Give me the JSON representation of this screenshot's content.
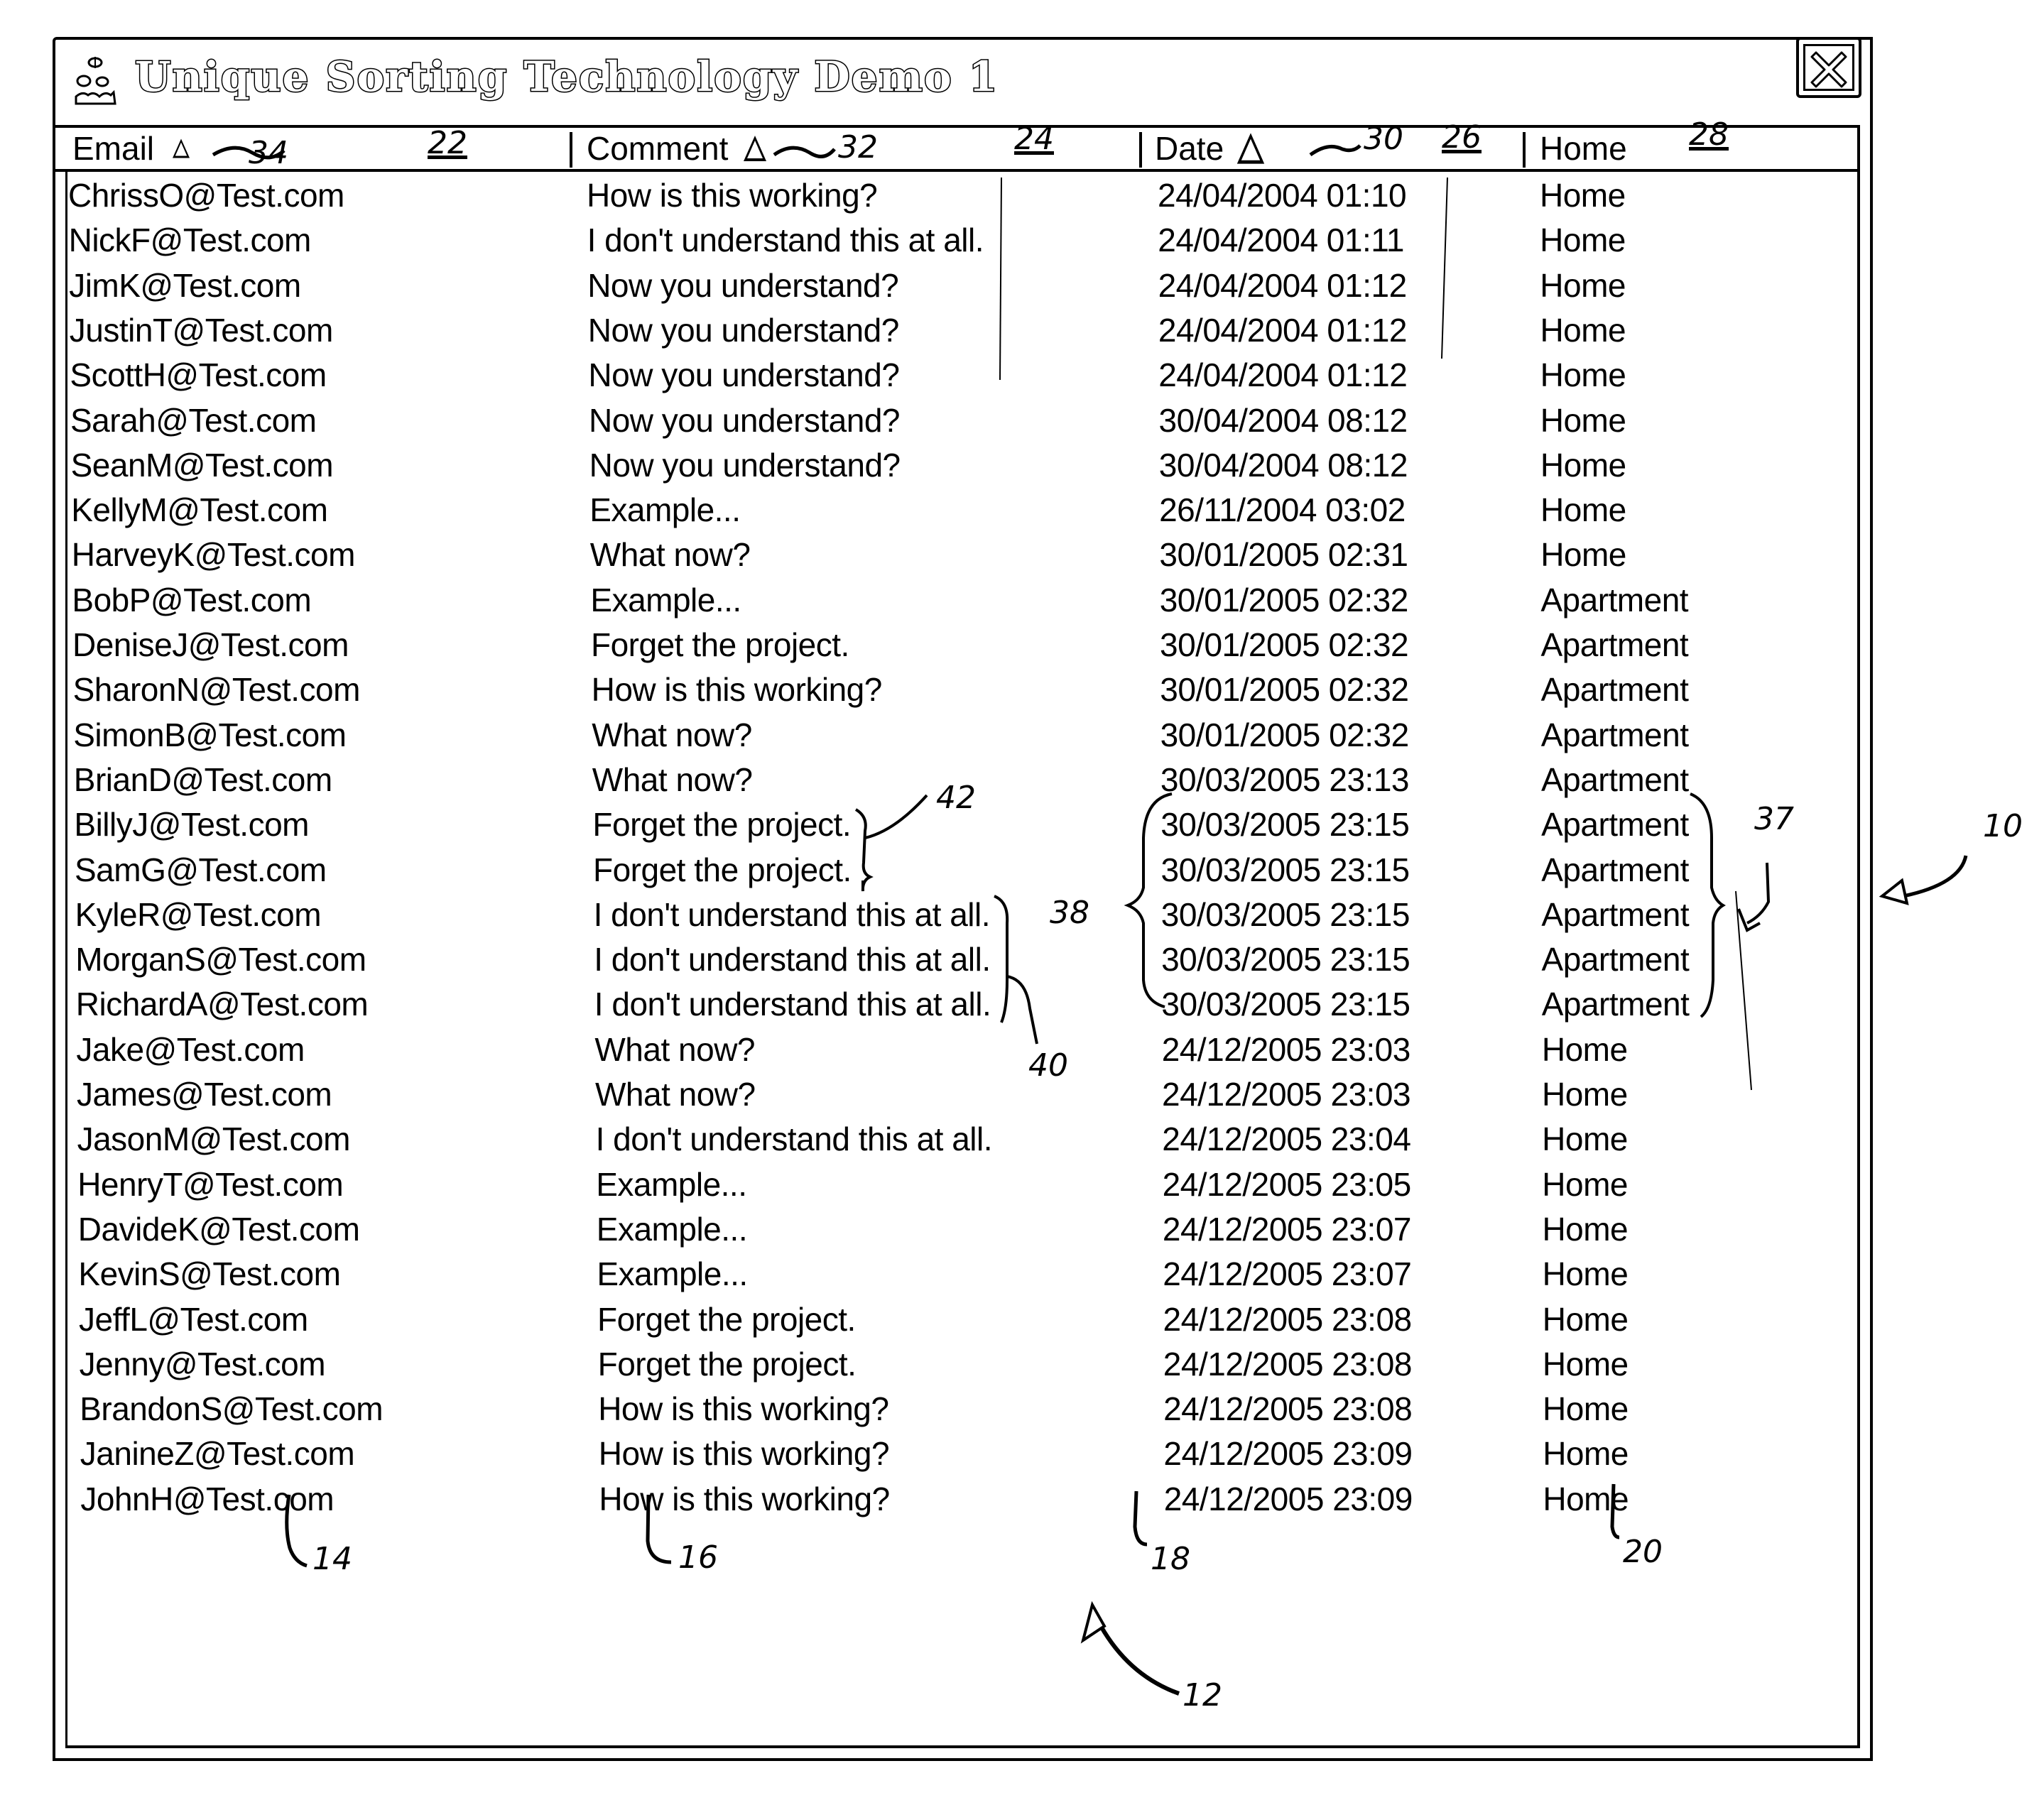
{
  "window": {
    "title": "Unique Sorting Technology Demo 1",
    "icon": "app-logo-icon",
    "close_icon": "close-icon"
  },
  "columns": [
    {
      "key": "email",
      "label": "Email",
      "sort_indicator": "sort-ascending-icon"
    },
    {
      "key": "comment",
      "label": "Comment",
      "sort_indicator": "sort-ascending-icon"
    },
    {
      "key": "date",
      "label": "Date",
      "sort_indicator": "sort-ascending-icon"
    },
    {
      "key": "home",
      "label": "Home",
      "sort_indicator": null
    }
  ],
  "rows": [
    {
      "email": "ChrissO@Test.com",
      "comment": "How is this working?",
      "date": "24/04/2004 01:10",
      "home": "Home"
    },
    {
      "email": "NickF@Test.com",
      "comment": "I don't understand this at all.",
      "date": "24/04/2004 01:11",
      "home": "Home"
    },
    {
      "email": "JimK@Test.com",
      "comment": "Now you understand?",
      "date": "24/04/2004 01:12",
      "home": "Home"
    },
    {
      "email": "JustinT@Test.com",
      "comment": "Now you understand?",
      "date": "24/04/2004 01:12",
      "home": "Home"
    },
    {
      "email": "ScottH@Test.com",
      "comment": "Now you understand?",
      "date": "24/04/2004 01:12",
      "home": "Home"
    },
    {
      "email": "Sarah@Test.com",
      "comment": "Now you understand?",
      "date": "30/04/2004 08:12",
      "home": "Home"
    },
    {
      "email": "SeanM@Test.com",
      "comment": "Now you understand?",
      "date": "30/04/2004 08:12",
      "home": "Home"
    },
    {
      "email": "KellyM@Test.com",
      "comment": "Example...",
      "date": "26/11/2004 03:02",
      "home": "Home"
    },
    {
      "email": "HarveyK@Test.com",
      "comment": "What now?",
      "date": "30/01/2005 02:31",
      "home": "Home"
    },
    {
      "email": "BobP@Test.com",
      "comment": "Example...",
      "date": "30/01/2005 02:32",
      "home": "Apartment"
    },
    {
      "email": "DeniseJ@Test.com",
      "comment": "Forget the project.",
      "date": "30/01/2005 02:32",
      "home": "Apartment"
    },
    {
      "email": "SharonN@Test.com",
      "comment": "How is this working?",
      "date": "30/01/2005 02:32",
      "home": "Apartment"
    },
    {
      "email": "SimonB@Test.com",
      "comment": "What now?",
      "date": "30/01/2005 02:32",
      "home": "Apartment"
    },
    {
      "email": "BrianD@Test.com",
      "comment": "What now?",
      "date": "30/03/2005 23:13",
      "home": "Apartment"
    },
    {
      "email": "BillyJ@Test.com",
      "comment": "Forget the project.",
      "date": "30/03/2005 23:15",
      "home": "Apartment"
    },
    {
      "email": "SamG@Test.com",
      "comment": "Forget the project.",
      "date": "30/03/2005 23:15",
      "home": "Apartment"
    },
    {
      "email": "KyleR@Test.com",
      "comment": "I don't understand this at all.",
      "date": "30/03/2005 23:15",
      "home": "Apartment"
    },
    {
      "email": "MorganS@Test.com",
      "comment": "I don't understand this at all.",
      "date": "30/03/2005 23:15",
      "home": "Apartment"
    },
    {
      "email": "RichardA@Test.com",
      "comment": "I don't understand this at all.",
      "date": "30/03/2005 23:15",
      "home": "Apartment"
    },
    {
      "email": "Jake@Test.com",
      "comment": "What now?",
      "date": "24/12/2005 23:03",
      "home": "Home"
    },
    {
      "email": "James@Test.com",
      "comment": "What now?",
      "date": "24/12/2005 23:03",
      "home": "Home"
    },
    {
      "email": "JasonM@Test.com",
      "comment": "I don't understand this at all.",
      "date": "24/12/2005 23:04",
      "home": "Home"
    },
    {
      "email": "HenryT@Test.com",
      "comment": "Example...",
      "date": "24/12/2005 23:05",
      "home": "Home"
    },
    {
      "email": "DavideK@Test.com",
      "comment": "Example...",
      "date": "24/12/2005 23:07",
      "home": "Home"
    },
    {
      "email": "KevinS@Test.com",
      "comment": "Example...",
      "date": "24/12/2005 23:07",
      "home": "Home"
    },
    {
      "email": "JeffL@Test.com",
      "comment": "Forget the project.",
      "date": "24/12/2005 23:08",
      "home": "Home"
    },
    {
      "email": "Jenny@Test.com",
      "comment": "Forget the project.",
      "date": "24/12/2005 23:08",
      "home": "Home"
    },
    {
      "email": "BrandonS@Test.com",
      "comment": "How is this working?",
      "date": "24/12/2005 23:08",
      "home": "Home"
    },
    {
      "email": "JanineZ@Test.com",
      "comment": "How is this working?",
      "date": "24/12/2005 23:09",
      "home": "Home"
    },
    {
      "email": "JohnH@Test.com",
      "comment": "How is this working?",
      "date": "24/12/2005 23:09",
      "home": "Home"
    }
  ],
  "annotations": {
    "email_sort": "34",
    "comment_sort": "32",
    "date_sort": "30",
    "email_col": "22",
    "comment_col": "24",
    "date_col": "26",
    "home_col": "28",
    "email_cell": "14",
    "comment_cell": "16",
    "date_cell": "18",
    "home_cell": "20",
    "grid": "12",
    "window": "10",
    "group_37": "37",
    "group_38": "38",
    "group_40": "40",
    "group_42": "42"
  }
}
